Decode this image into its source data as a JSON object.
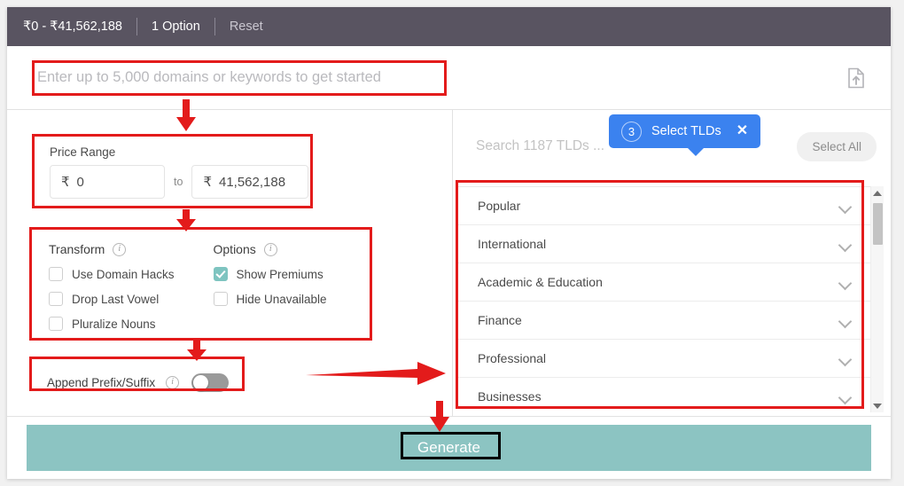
{
  "filter_bar": {
    "price_summary": "₹0 - ₹41,562,188",
    "option_count": "1 Option",
    "reset_label": "Reset",
    "background": "#595461"
  },
  "search": {
    "placeholder": "Enter up to 5,000 domains or keywords to get started",
    "value": "",
    "upload_icon": "file-upload-icon"
  },
  "price_range": {
    "label": "Price Range",
    "currency_symbol": "₹",
    "min_value": "0",
    "max_value": "41,562,188",
    "separator_label": "to"
  },
  "transform": {
    "heading": "Transform",
    "info_icon": "info-icon",
    "checkboxes": [
      {
        "label": "Use Domain Hacks",
        "checked": false
      },
      {
        "label": "Drop Last Vowel",
        "checked": false
      },
      {
        "label": "Pluralize Nouns",
        "checked": false
      }
    ]
  },
  "options": {
    "heading": "Options",
    "info_icon": "info-icon",
    "checkboxes": [
      {
        "label": "Show Premiums",
        "checked": true
      },
      {
        "label": "Hide Unavailable",
        "checked": false
      }
    ],
    "checked_color": "#7ec4c0"
  },
  "append": {
    "label": "Append Prefix/Suffix",
    "info_icon": "info-icon",
    "toggle_on": false
  },
  "tld_panel": {
    "search_placeholder": "Search 1187 TLDs ...",
    "search_value": "",
    "select_all_label": "Select All",
    "tooltip": {
      "step_number": "3",
      "text": "Select TLDs",
      "close_icon": "close-icon",
      "background": "#3b82ef"
    },
    "categories": [
      {
        "label": "Popular"
      },
      {
        "label": "International"
      },
      {
        "label": "Academic & Education"
      },
      {
        "label": "Finance"
      },
      {
        "label": "Professional"
      },
      {
        "label": "Businesses"
      }
    ],
    "chevron_icon": "chevron-down-icon"
  },
  "generate": {
    "label": "Generate",
    "background": "#8cc4c2"
  },
  "annotations": {
    "highlight_color": "#e31b1b",
    "emphasis_color": "#000000"
  }
}
